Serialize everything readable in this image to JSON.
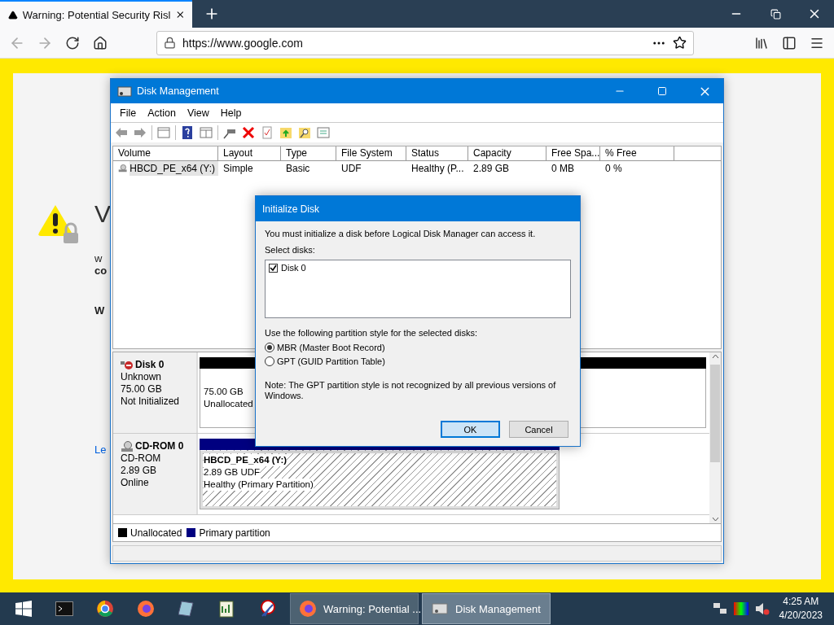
{
  "browser": {
    "tab": {
      "title": "Warning: Potential Security Risl"
    },
    "address": "https://www.google.com"
  },
  "page": {
    "heading": "V",
    "lines": [
      {
        "text": "w",
        "bold": false
      },
      {
        "text": "co",
        "bold": true
      },
      {
        "text": "W",
        "bold": true
      }
    ],
    "link": "Le"
  },
  "disk_management": {
    "title": "Disk Management",
    "menu": [
      "File",
      "Action",
      "View",
      "Help"
    ],
    "columns": [
      "Volume",
      "Layout",
      "Type",
      "File System",
      "Status",
      "Capacity",
      "Free Spa...",
      "% Free"
    ],
    "rows": [
      {
        "cells": [
          "HBCD_PE_x64 (Y:)",
          "Simple",
          "Basic",
          "UDF",
          "Healthy (P...",
          "2.89 GB",
          "0 MB",
          "0 %"
        ],
        "selected": true
      }
    ],
    "disks": [
      {
        "kind": "hdd",
        "name": "Disk 0",
        "lines": [
          "Unknown",
          "75.00 GB",
          "Not Initialized"
        ],
        "partition": {
          "kind": "unallocated",
          "lines": [
            "75.00 GB",
            "Unallocated"
          ]
        }
      },
      {
        "kind": "cdrom",
        "name": "CD-ROM 0",
        "lines": [
          "CD-ROM",
          "2.89 GB",
          "Online"
        ],
        "partition": {
          "kind": "primary",
          "title": "HBCD_PE_x64  (Y:)",
          "lines": [
            "2.89 GB UDF",
            "Healthy (Primary Partition)"
          ]
        }
      }
    ],
    "legend": [
      {
        "label": "Unallocated",
        "color": "#000000"
      },
      {
        "label": "Primary partition",
        "color": "#000080"
      }
    ]
  },
  "dialog": {
    "title": "Initialize Disk",
    "message": "You must initialize a disk before Logical Disk Manager can access it.",
    "select_label": "Select disks:",
    "disks": [
      {
        "label": "Disk 0",
        "checked": true
      }
    ],
    "style_label": "Use the following partition style for the selected disks:",
    "options": [
      {
        "label": "MBR (Master Boot Record)",
        "selected": true
      },
      {
        "label": "GPT (GUID Partition Table)",
        "selected": false
      }
    ],
    "note": "Note: The GPT partition style is not recognized by all previous versions of Windows.",
    "buttons": [
      {
        "label": "OK",
        "focused": true
      },
      {
        "label": "Cancel",
        "focused": false
      }
    ]
  },
  "taskbar": {
    "windows": [
      {
        "kind": "firefox",
        "title": "Warning: Potential ...",
        "selected": false
      },
      {
        "kind": "disk",
        "title": "Disk Management",
        "selected": true
      }
    ],
    "time": "4:25 AM",
    "date": "4/20/2023"
  }
}
